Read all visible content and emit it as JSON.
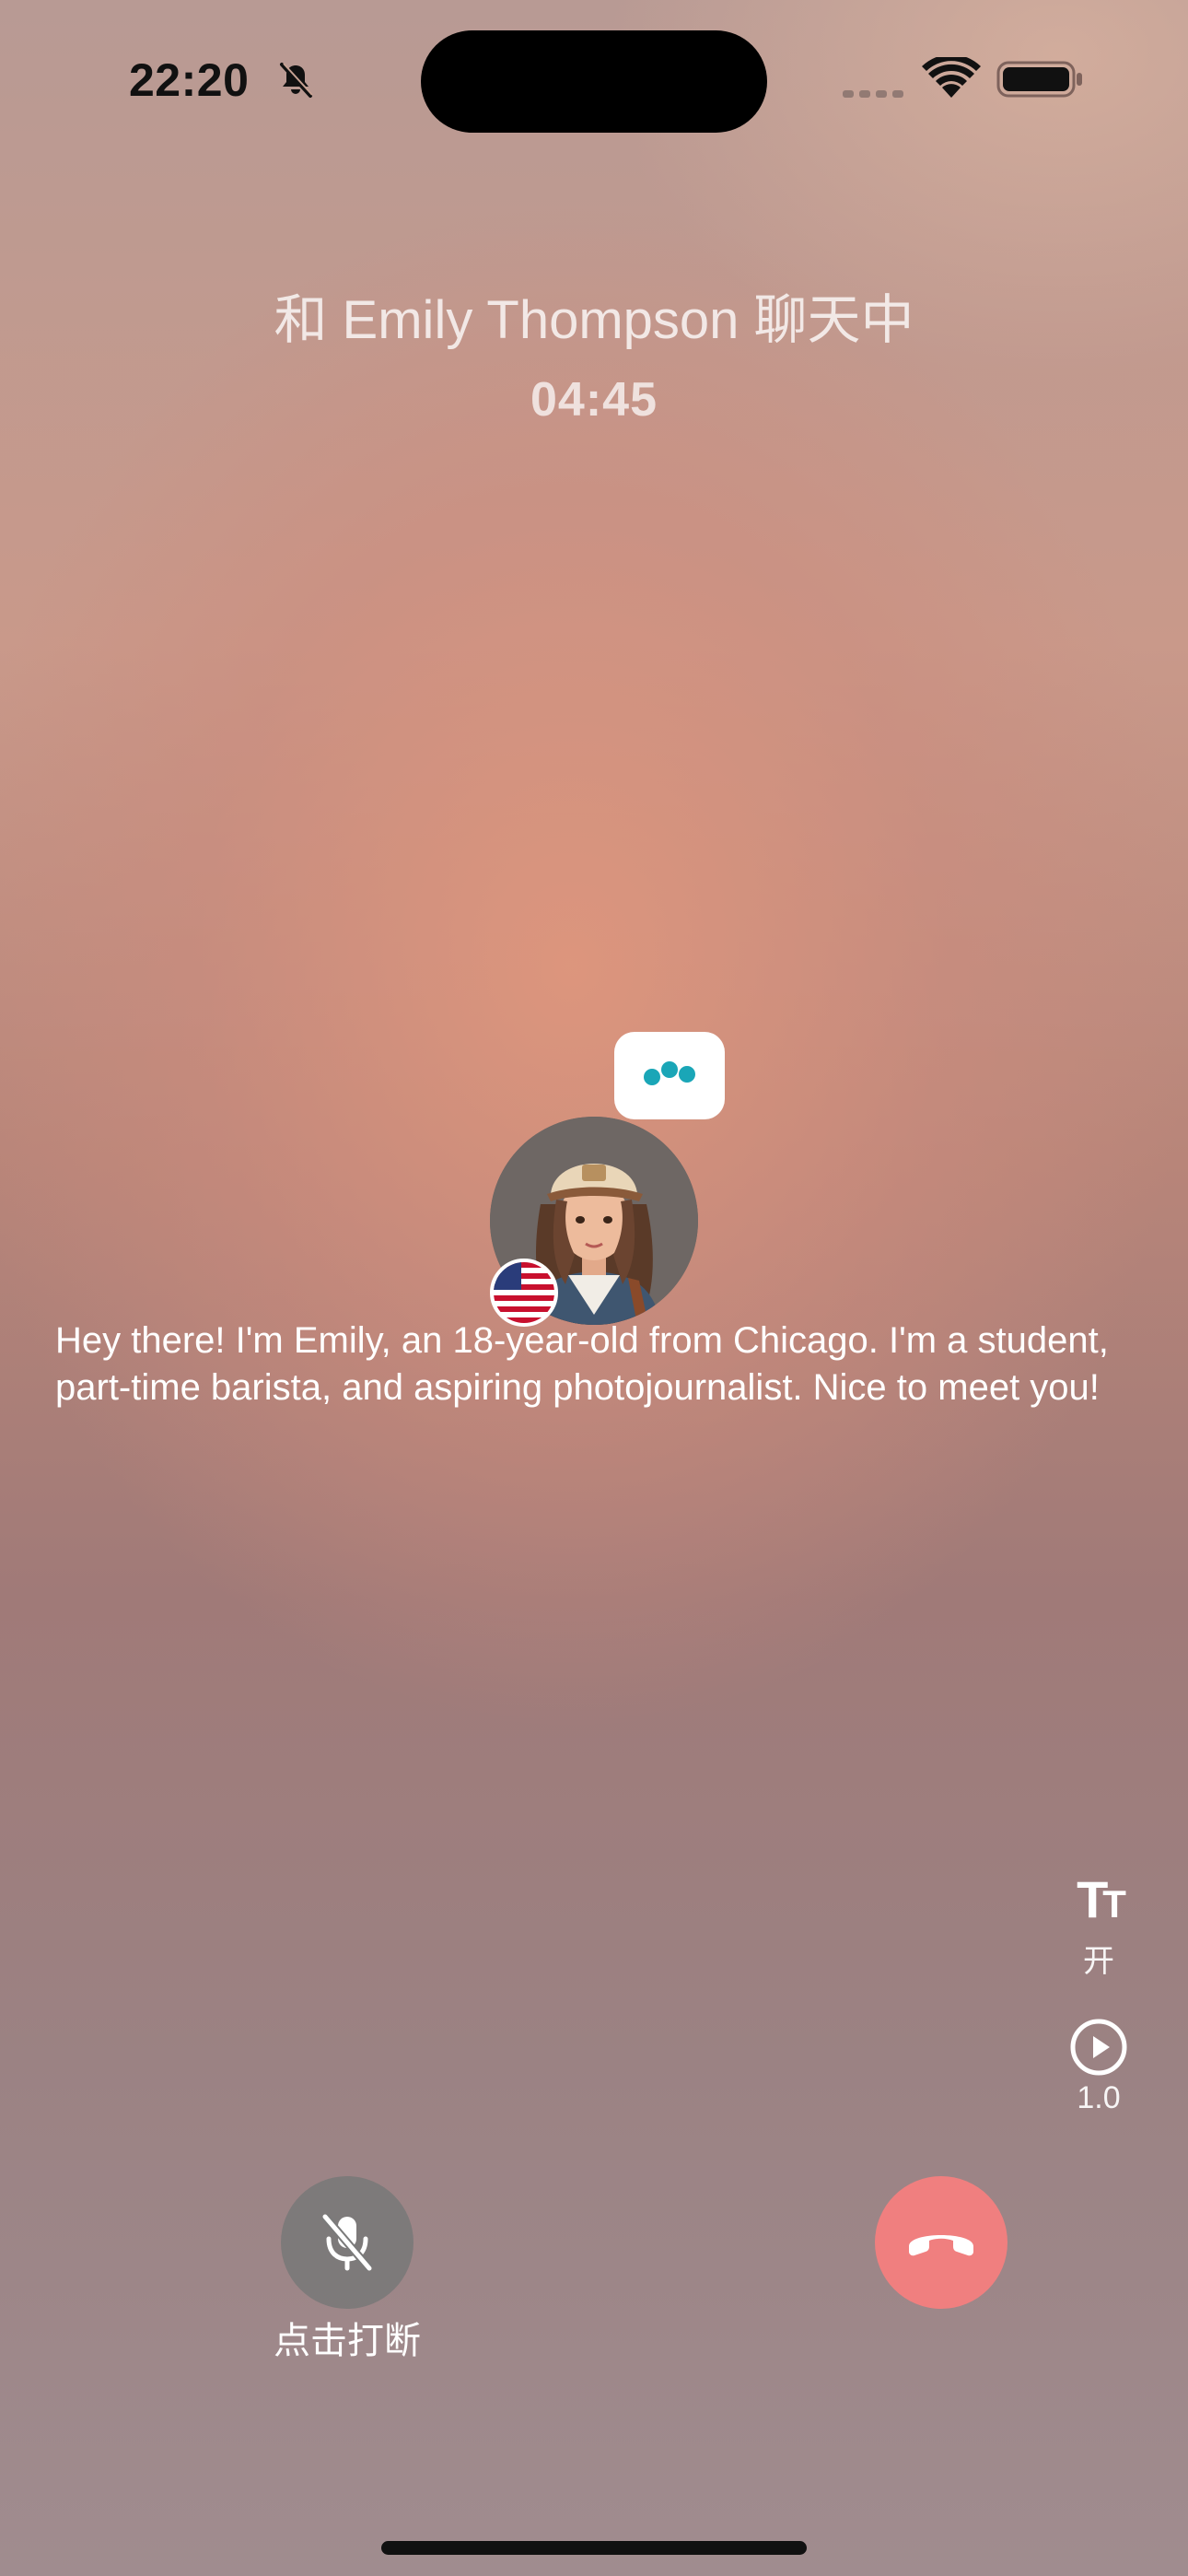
{
  "status_bar": {
    "time": "22:20",
    "icons": [
      "bell-slash-icon",
      "cellular-signal-icon",
      "wifi-icon",
      "battery-icon"
    ]
  },
  "call": {
    "title": "和 Emily Thompson 聊天中",
    "timer": "04:45"
  },
  "speaker": {
    "typing_indicator": "typing-dots-icon",
    "avatar": "avatar",
    "flag": "us-flag-icon"
  },
  "transcript": {
    "text": "Hey there! I'm Emily, an 18-year-old from Chicago. I'm a student, part-time barista, and aspiring photojournalist. Nice to meet you!"
  },
  "side_controls": {
    "subtitles": {
      "icon": "text-size-icon",
      "label": "开"
    },
    "speed": {
      "icon": "play-circle-icon",
      "label": "1.0"
    }
  },
  "bottom_controls": {
    "mic": {
      "icon": "mic-off-icon",
      "label": "点击打断"
    },
    "hangup": {
      "icon": "phone-hangup-icon"
    }
  },
  "colors": {
    "accent_typing": "#1aa6b7",
    "hangup": "#f07f7f",
    "mic_button": "#787878"
  }
}
